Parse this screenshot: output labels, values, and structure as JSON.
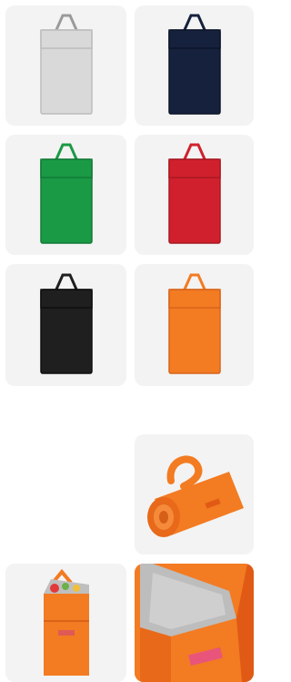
{
  "gallery": {
    "products": [
      {
        "id": "grey",
        "color_name": "grey",
        "color": "#d9d9d9",
        "edge": "#bcbcbc",
        "handle": "#9a9a9a"
      },
      {
        "id": "navy",
        "color_name": "navy",
        "color": "#16213d",
        "edge": "#0d1428",
        "handle": "#16213d"
      },
      {
        "id": "green",
        "color_name": "green",
        "color": "#1a9a45",
        "edge": "#137a36",
        "handle": "#1a9a45"
      },
      {
        "id": "red",
        "color_name": "red",
        "color": "#d1202d",
        "edge": "#a81822",
        "handle": "#d1202d"
      },
      {
        "id": "black",
        "color_name": "black",
        "color": "#1f1f1f",
        "edge": "#0f0f0f",
        "handle": "#1f1f1f"
      },
      {
        "id": "orange",
        "color_name": "orange",
        "color": "#f37b22",
        "edge": "#d8641a",
        "handle": "#f37b22"
      }
    ],
    "detail_images": [
      {
        "id": "rolled",
        "icon": "rolled-bag-icon",
        "color": "#f37b22"
      },
      {
        "id": "open-bag",
        "icon": "open-bag-icon",
        "color": "#f37b22"
      },
      {
        "id": "inner-lining",
        "icon": "lining-closeup-icon",
        "color": "#f37b22"
      }
    ]
  }
}
